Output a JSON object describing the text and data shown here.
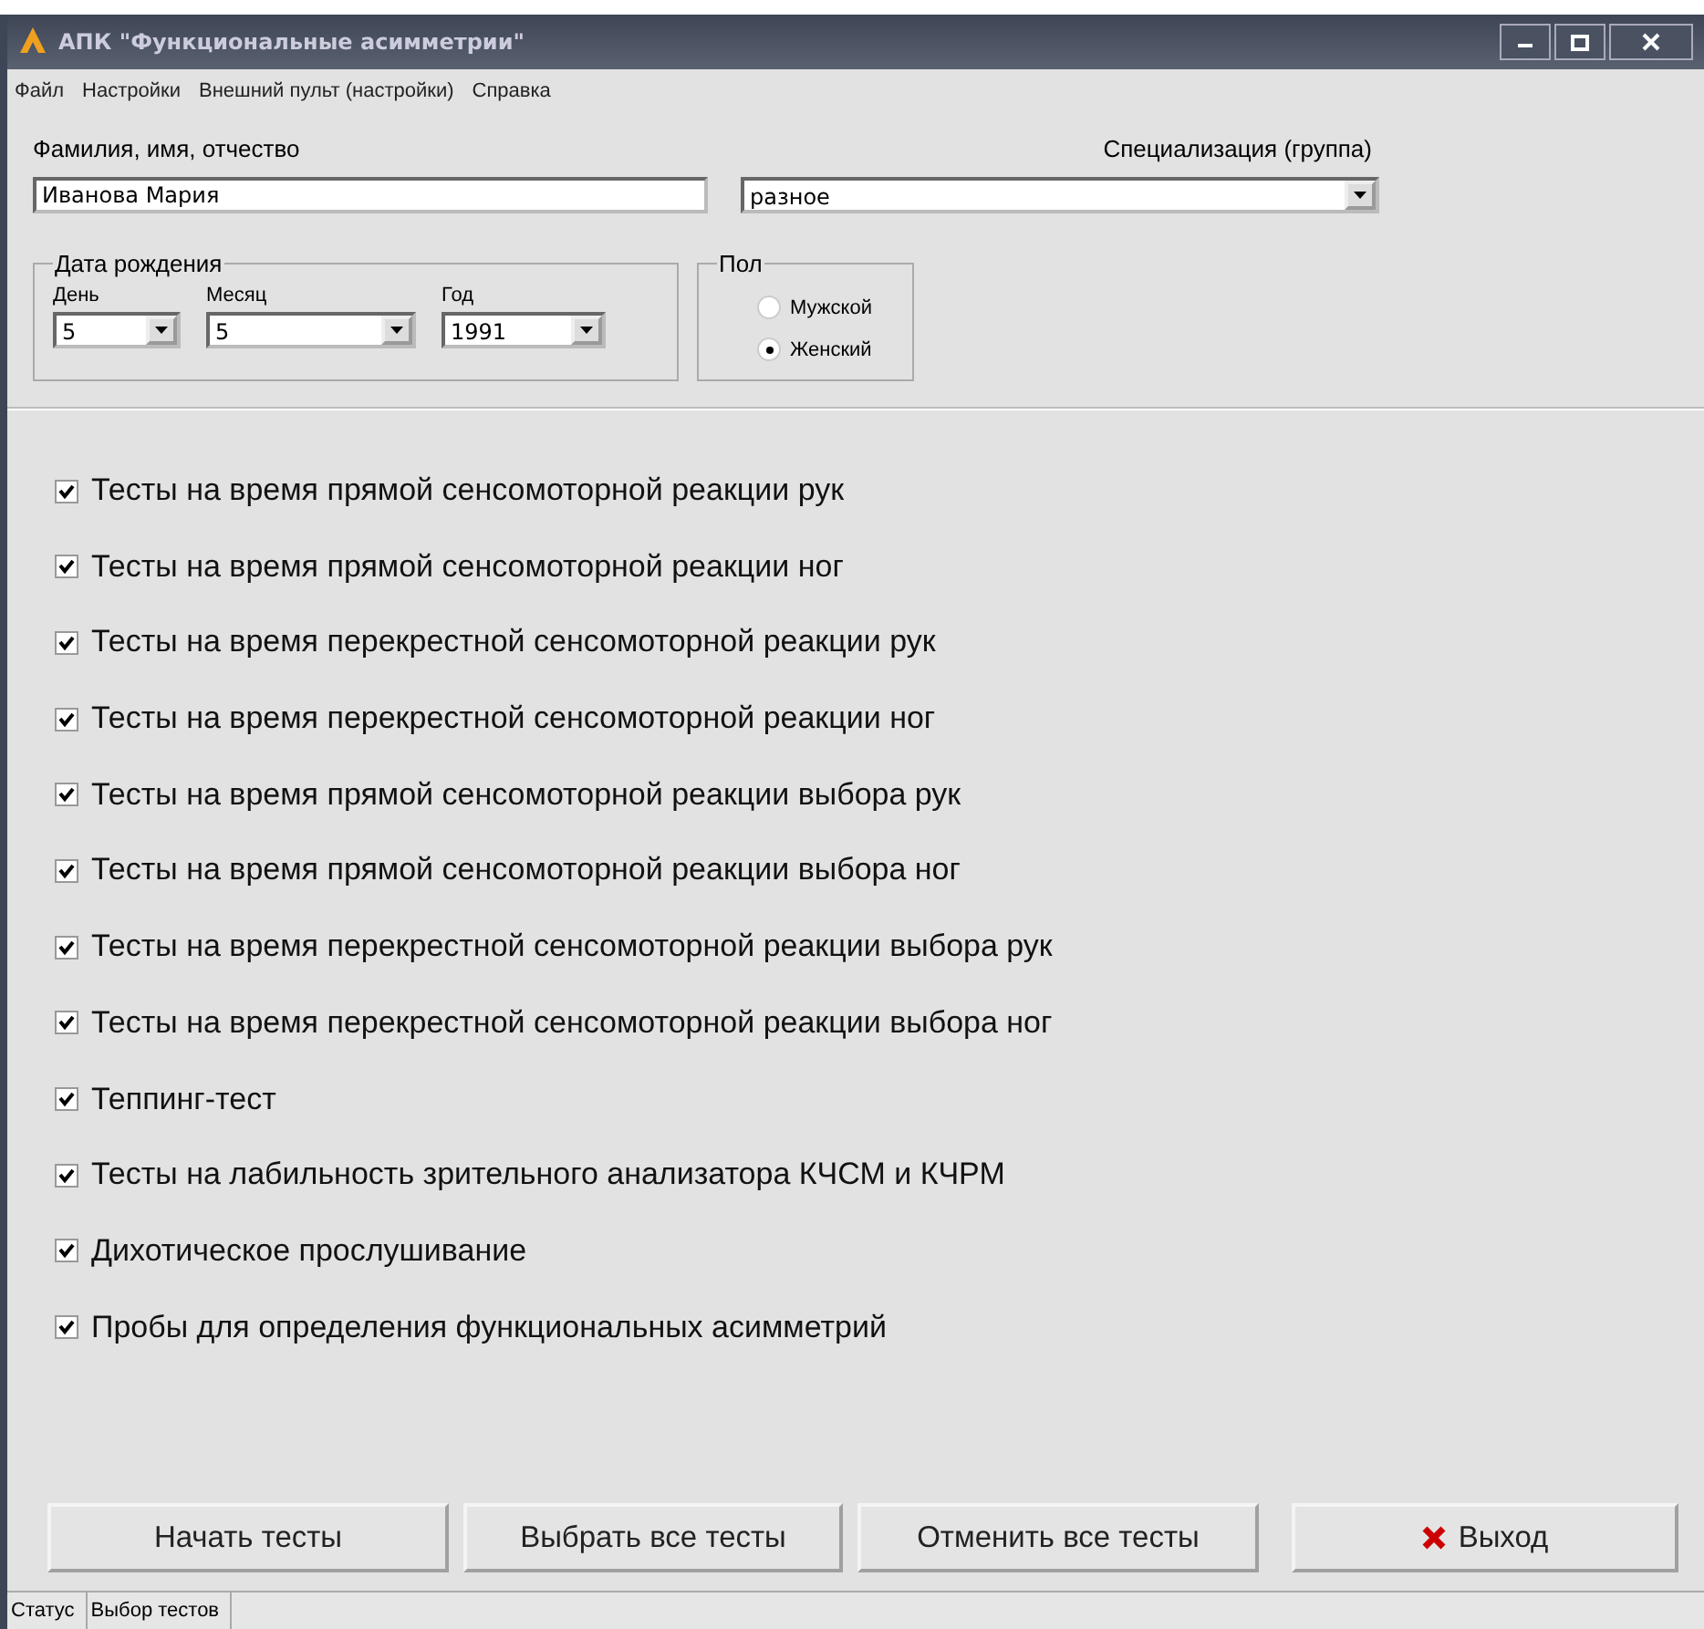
{
  "window": {
    "title": "АПК \"Функциональные асимметрии\""
  },
  "menu": [
    "Файл",
    "Настройки",
    "Внешний пульт (настройки)",
    "Справка"
  ],
  "name_field": {
    "label": "Фамилия, имя, отчество",
    "value": "Иванова Мария"
  },
  "specialization": {
    "label": "Специализация (группа)",
    "value": "разное"
  },
  "birth_date": {
    "title": "Дата рождения",
    "fields": [
      {
        "label": "День",
        "value": "5"
      },
      {
        "label": "Месяц",
        "value": "5"
      },
      {
        "label": "Год",
        "value": "1991"
      }
    ]
  },
  "sex": {
    "title": "Пол",
    "options": [
      {
        "label": "Мужской",
        "selected": false
      },
      {
        "label": "Женский",
        "selected": true
      }
    ]
  },
  "tests": [
    {
      "label": "Тесты на время прямой сенсомоторной реакции рук",
      "checked": true
    },
    {
      "label": "Тесты на время прямой сенсомоторной реакции ног",
      "checked": true
    },
    {
      "label": "Тесты на время перекрестной сенсомоторной реакции рук",
      "checked": true
    },
    {
      "label": "Тесты на время перекрестной сенсомоторной реакции ног",
      "checked": true
    },
    {
      "label": "Тесты на время прямой сенсомоторной реакции выбора рук",
      "checked": true
    },
    {
      "label": "Тесты на время прямой сенсомоторной реакции выбора ног",
      "checked": true
    },
    {
      "label": "Тесты на время перекрестной сенсомоторной реакции выбора рук",
      "checked": true
    },
    {
      "label": "Тесты на время перекрестной сенсомоторной реакции выбора ног",
      "checked": true
    },
    {
      "label": "Теппинг-тест",
      "checked": true
    },
    {
      "label": "Тесты на лабильность зрительного анализатора КЧСМ и КЧРМ",
      "checked": true
    },
    {
      "label": "Дихотическое прослушивание",
      "checked": true
    },
    {
      "label": "Пробы для определения функциональных асимметрий",
      "checked": true
    }
  ],
  "buttons": [
    {
      "label": "Начать тесты",
      "kind": "plain"
    },
    {
      "label": "Выбрать все тесты",
      "kind": "plain"
    },
    {
      "label": "Отменить все тесты",
      "kind": "plain"
    },
    {
      "label": "Выход",
      "kind": "exit"
    }
  ],
  "status_bar": [
    "Статус",
    "Выбор тестов"
  ]
}
